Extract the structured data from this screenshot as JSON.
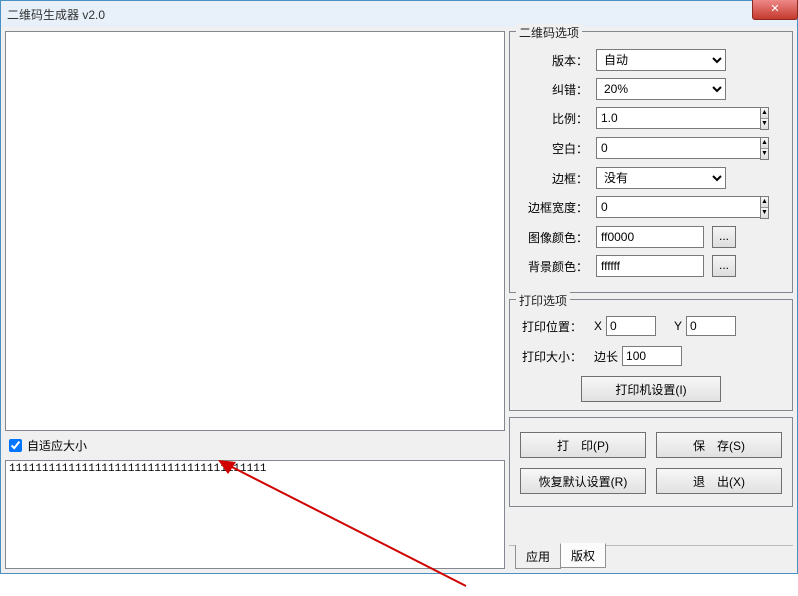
{
  "window": {
    "title": "二维码生成器 v2.0"
  },
  "left": {
    "adaptive_label": "自适应大小",
    "adaptive_checked": true,
    "input_text": "111111111111111111111111111111111111111"
  },
  "qr_options": {
    "group_title": "二维码选项",
    "version_label": "版本：",
    "version_value": "自动",
    "correction_label": "纠错：",
    "correction_value": "20%",
    "scale_label": "比例：",
    "scale_value": "1.0",
    "margin_label": "空白：",
    "margin_value": "0",
    "border_label": "边框：",
    "border_value": "没有",
    "border_width_label": "边框宽度：",
    "border_width_value": "0",
    "image_color_label": "图像颜色：",
    "image_color_value": "ff0000",
    "bg_color_label": "背景颜色：",
    "bg_color_value": "ffffff"
  },
  "print_options": {
    "group_title": "打印选项",
    "position_label": "打印位置：",
    "x_label": "X",
    "x_value": "0",
    "y_label": "Y",
    "y_value": "0",
    "size_label": "打印大小：",
    "edge_label": "边长",
    "edge_value": "100",
    "printer_setup": "打印机设置(I)"
  },
  "actions": {
    "print": "打　印(P)",
    "save": "保　存(S)",
    "restore": "恢复默认设置(R)",
    "exit": "退　出(X)"
  },
  "tabs": {
    "app": "应用",
    "copyright": "版权"
  },
  "color_browse": "..."
}
